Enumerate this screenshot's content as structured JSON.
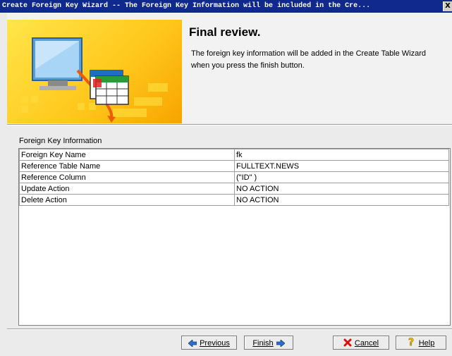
{
  "window": {
    "title": "Create Foreign Key Wizard --  The Foreign Key Information will be included in the Cre...",
    "close_glyph": "X"
  },
  "header": {
    "title": "Final review.",
    "description": "The foreign key information will be added in the Create Table Wizard when you press the finish button."
  },
  "section": {
    "label": "Foreign Key Information"
  },
  "table": {
    "rows": [
      {
        "name": "Foreign Key Name",
        "value": "fk"
      },
      {
        "name": "Reference Table Name",
        "value": "FULLTEXT.NEWS"
      },
      {
        "name": "Reference Column",
        "value": "(\"ID\" )"
      },
      {
        "name": "Update Action",
        "value": "NO ACTION"
      },
      {
        "name": "Delete Action",
        "value": "NO ACTION"
      }
    ]
  },
  "buttons": {
    "previous": "Previous",
    "finish": "Finish",
    "cancel": "Cancel",
    "help": "Help"
  },
  "icons": {
    "previous": "arrow-left-icon",
    "finish": "arrow-right-icon",
    "cancel": "red-x-icon",
    "help": "question-mark-icon",
    "banner": "computer-table-illustration"
  },
  "colors": {
    "titlebar": "#10298c",
    "banner": "#ffc61a"
  }
}
